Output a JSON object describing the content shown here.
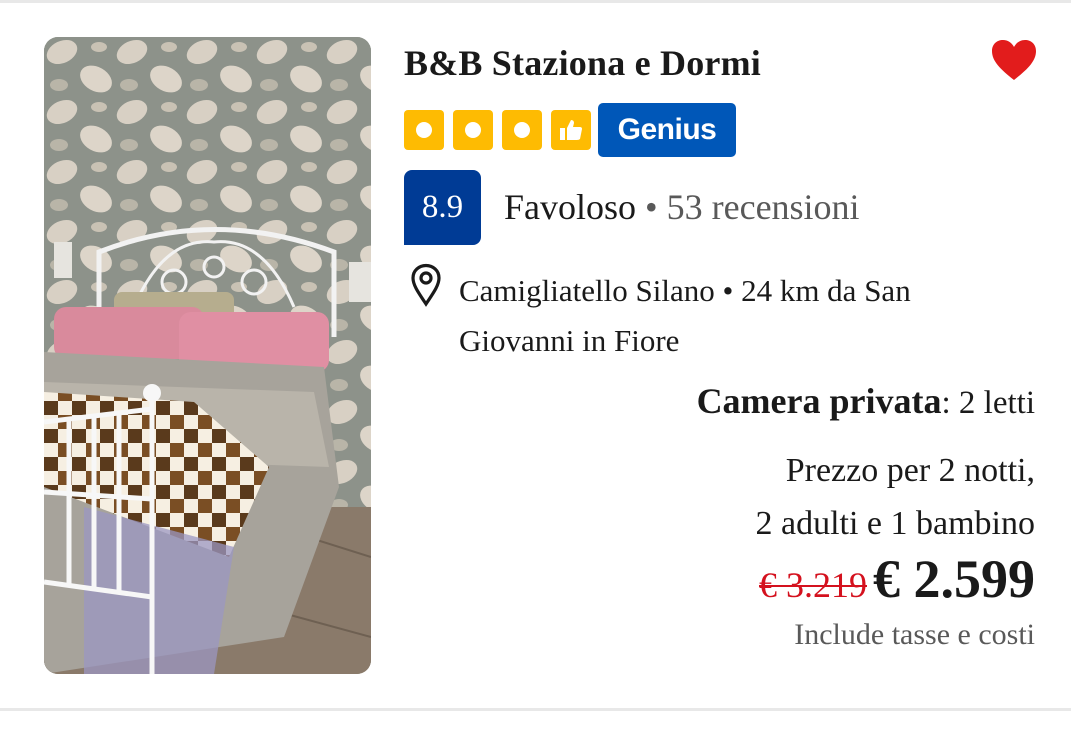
{
  "listing": {
    "title": "B&B Staziona e Dormi",
    "favorite_icon": "heart-icon",
    "favorite_color": "#e21c1c",
    "stars_color": "#febb02",
    "stars_count": 4,
    "badge": "Genius",
    "badge_color": "#0057b8",
    "score": "8.9",
    "score_color": "#003b95",
    "score_word": "Favoloso",
    "separator": "•",
    "reviews": "53 recensioni",
    "location": "Camigliatello Silano • 24 km da San Giovanni in Fiore",
    "room_type": "Camera privata",
    "room_beds": ": 2 letti",
    "price_for_line1": "Prezzo per 2 notti,",
    "price_for_line2": "2 adulti e 1 bambino",
    "old_price": "€ 3.219",
    "price": "€ 2.599",
    "old_price_color": "#d4111e",
    "taxes_note": "Include tasse e costi"
  }
}
